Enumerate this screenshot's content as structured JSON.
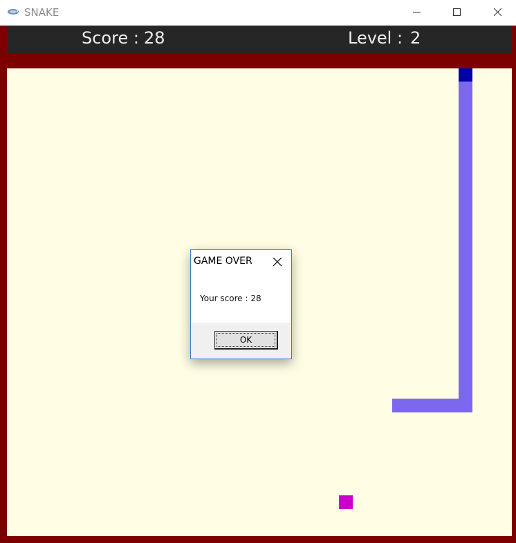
{
  "window": {
    "title": "SNAKE",
    "icon": "snake-app-icon",
    "controls": [
      "minimize-icon",
      "maximize-icon",
      "close-icon"
    ]
  },
  "hud": {
    "score_label": "Score :",
    "score_value": "28",
    "level_label": "Level :",
    "level_value": "2"
  },
  "colors": {
    "frame": "#7d0000",
    "hud_background": "#262626",
    "board": "#fffee5",
    "snake_body": "#7b68ee",
    "snake_head": "#0000aa",
    "food": "#cc00cc"
  },
  "dialog": {
    "title": "GAME OVER",
    "message": "Your score : 28",
    "ok_label": "OK",
    "close_icon": "close-icon"
  }
}
